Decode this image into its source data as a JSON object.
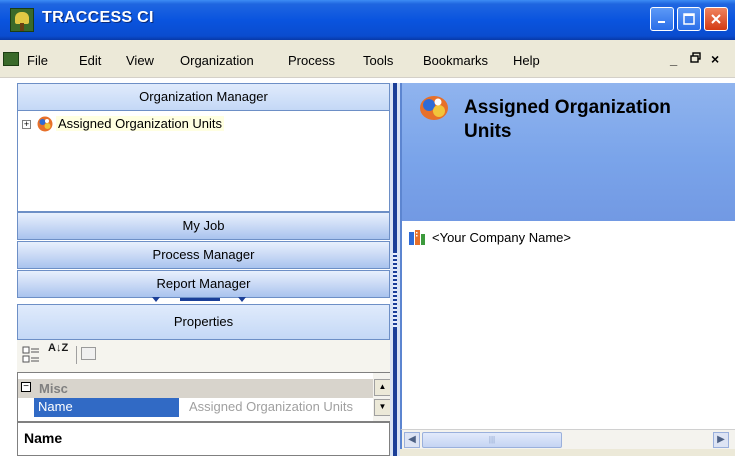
{
  "window": {
    "title": "TRACCESS CI"
  },
  "menu": {
    "items": [
      "File",
      "Edit",
      "View",
      "Organization",
      "Process",
      "Tools",
      "Bookmarks",
      "Help"
    ],
    "mdi_min": "_",
    "mdi_restore": "ƀ",
    "mdi_close": "×"
  },
  "org_manager": {
    "header": "Organization Manager",
    "tree": [
      {
        "label": "Assigned Organization Units",
        "expander": "+"
      }
    ]
  },
  "nav": {
    "my_job": "My Job",
    "process_manager": "Process Manager",
    "report_manager": "Report Manager"
  },
  "properties": {
    "header": "Properties",
    "alpha_sort_glyph": "A↓Z",
    "category": {
      "label": "Misc",
      "toggle": "−"
    },
    "rows": [
      {
        "name": "Name",
        "value": "Assigned Organization Units"
      }
    ],
    "description_title": "Name"
  },
  "detail": {
    "title": "Assigned Organization Units",
    "items": [
      {
        "label": "<Your Company Name>"
      }
    ]
  },
  "colors": {
    "accent": "#0a54df",
    "selection": "#316ac5",
    "header_blue": "#7aa4ea"
  },
  "icons": [
    "app-icon",
    "expand-plus-icon",
    "org-units-icon",
    "company-icon",
    "categorized-icon",
    "alphabetical-sort-icon",
    "property-pages-icon"
  ]
}
